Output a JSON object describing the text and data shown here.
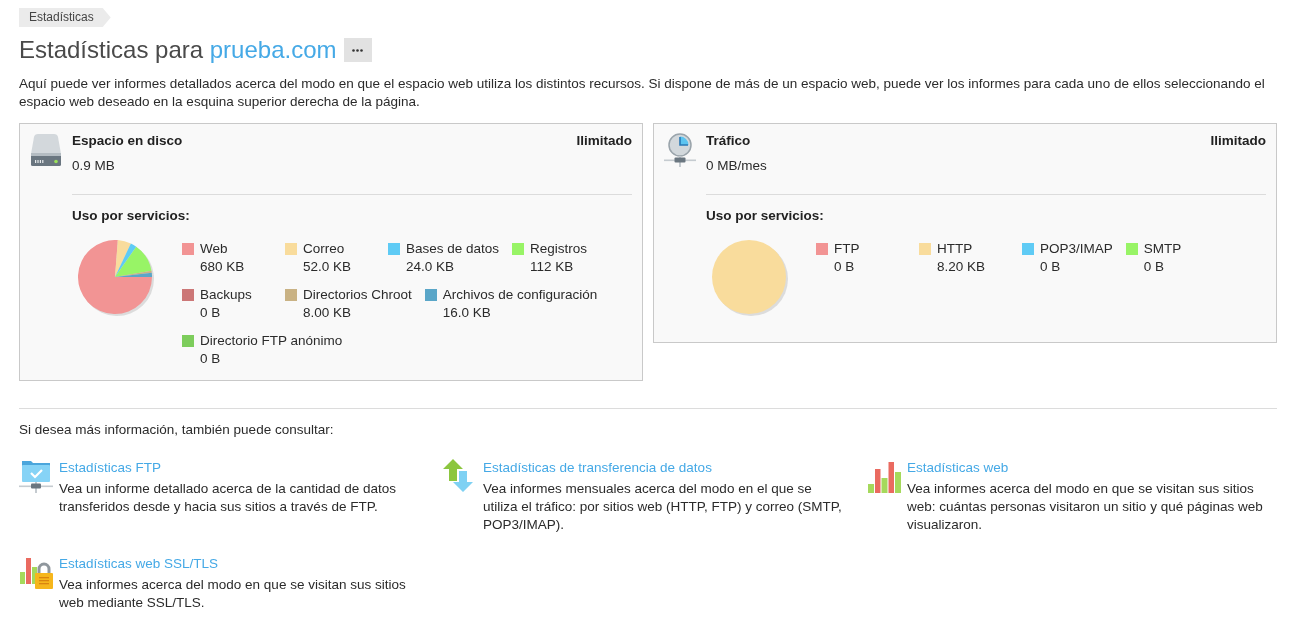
{
  "breadcrumb": [
    {
      "label": "Estadísticas"
    }
  ],
  "heading": {
    "title": "Estadísticas para",
    "domain": "prueba.com"
  },
  "description": "Aquí puede ver informes detallados acerca del modo en que el espacio web utiliza los distintos recursos. Si dispone de más de un espacio web, puede ver los informes para cada uno de ellos seleccionando el espacio web deseado en la esquina superior derecha de la página.",
  "panels": [
    {
      "kind": "disk",
      "title": "Espacio en disco",
      "limit": "Ilimitado",
      "total": "0.9 MB",
      "usage_label": "Uso por servicios:",
      "legend": [
        {
          "label": "Web",
          "value": "680 KB",
          "color": "#f29494"
        },
        {
          "label": "Correo",
          "value": "52.0 KB",
          "color": "#f9dc9c"
        },
        {
          "label": "Bases de datos",
          "value": "24.0 KB",
          "color": "#5fcbf5"
        },
        {
          "label": "Registros",
          "value": "112 KB",
          "color": "#98f466"
        },
        {
          "label": "Backups",
          "value": "0 B",
          "color": "#cc7777"
        },
        {
          "label": "Directorios Chroot",
          "value": "8.00 KB",
          "color": "#c9b284"
        },
        {
          "label": "Archivos de configuración",
          "value": "16.0 KB",
          "color": "#5aa6c8"
        },
        {
          "label": "Directorio FTP anónimo",
          "value": "0 B",
          "color": "#7dcd5c"
        }
      ],
      "chart_data": {
        "type": "pie",
        "values": [
          76.23,
          5.83,
          2.69,
          12.56,
          0,
          0.9,
          1.79,
          0
        ]
      }
    },
    {
      "kind": "traffic",
      "title": "Tráfico",
      "limit": "Ilimitado",
      "total": "0 MB/mes",
      "usage_label": "Uso por servicios:",
      "legend": [
        {
          "label": "FTP",
          "value": "0 B",
          "color": "#f29494"
        },
        {
          "label": "HTTP",
          "value": "8.20 KB",
          "color": "#f9dc9c"
        },
        {
          "label": "POP3/IMAP",
          "value": "0 B",
          "color": "#5fcbf5"
        },
        {
          "label": "SMTP",
          "value": "0 B",
          "color": "#98f466"
        }
      ],
      "chart_data": {
        "type": "pie",
        "values": [
          0,
          100,
          0,
          0
        ]
      }
    }
  ],
  "more_info": {
    "intro": "Si desea más información, también puede consultar:",
    "links": [
      {
        "kind": "ftp",
        "title": "Estadísticas FTP",
        "description": "Vea un informe detallado acerca de la cantidad de datos transferidos desde y hacia sus sitios a través de FTP."
      },
      {
        "kind": "transfer",
        "title": "Estadísticas de transferencia de datos",
        "description": "Vea informes mensuales acerca del modo en el que se utiliza el tráfico: por sitios web (HTTP, FTP) y correo (SMTP, POP3/IMAP)."
      },
      {
        "kind": "web",
        "title": "Estadísticas web",
        "description": "Vea informes acerca del modo en que se visitan sus sitios web: cuántas personas visitaron un sitio y qué páginas web visualizaron."
      },
      {
        "kind": "ssl",
        "title": "Estadísticas web SSL/TLS",
        "description": "Vea informes acerca del modo en que se visitan sus sitios web mediante SSL/TLS."
      }
    ]
  }
}
